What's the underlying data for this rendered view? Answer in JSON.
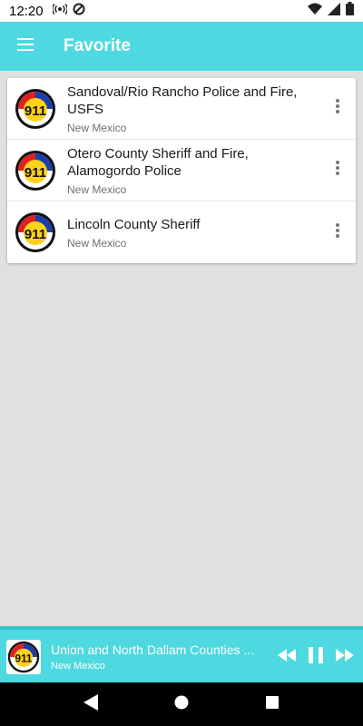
{
  "status_bar": {
    "time": "12:20",
    "icons": [
      "radio-broadcast-icon",
      "no-disturb-icon",
      "wifi-icon",
      "signal-icon",
      "battery-icon"
    ]
  },
  "app_bar": {
    "title": "Favorite",
    "menu_icon": "hamburger-menu-icon",
    "color": "#4dd9df"
  },
  "favorites": [
    {
      "title": "Sandoval/Rio Rancho Police and Fire, USFS",
      "subtitle": "New Mexico",
      "logo": "911-logo-icon",
      "menu_icon": "more-vert-icon"
    },
    {
      "title": "Otero County Sheriff and Fire, Alamogordo Police",
      "subtitle": "New Mexico",
      "logo": "911-logo-icon",
      "menu_icon": "more-vert-icon"
    },
    {
      "title": "Lincoln County Sheriff",
      "subtitle": "New Mexico",
      "logo": "911-logo-icon",
      "menu_icon": "more-vert-icon"
    }
  ],
  "player": {
    "title": "Union and North Dallam Counties ...",
    "subtitle": "New Mexico",
    "logo": "911-logo-icon",
    "controls": [
      "rewind-icon",
      "pause-icon",
      "fast-forward-icon"
    ]
  },
  "nav_bar": {
    "buttons": [
      "back-icon",
      "home-icon",
      "recents-icon"
    ]
  }
}
